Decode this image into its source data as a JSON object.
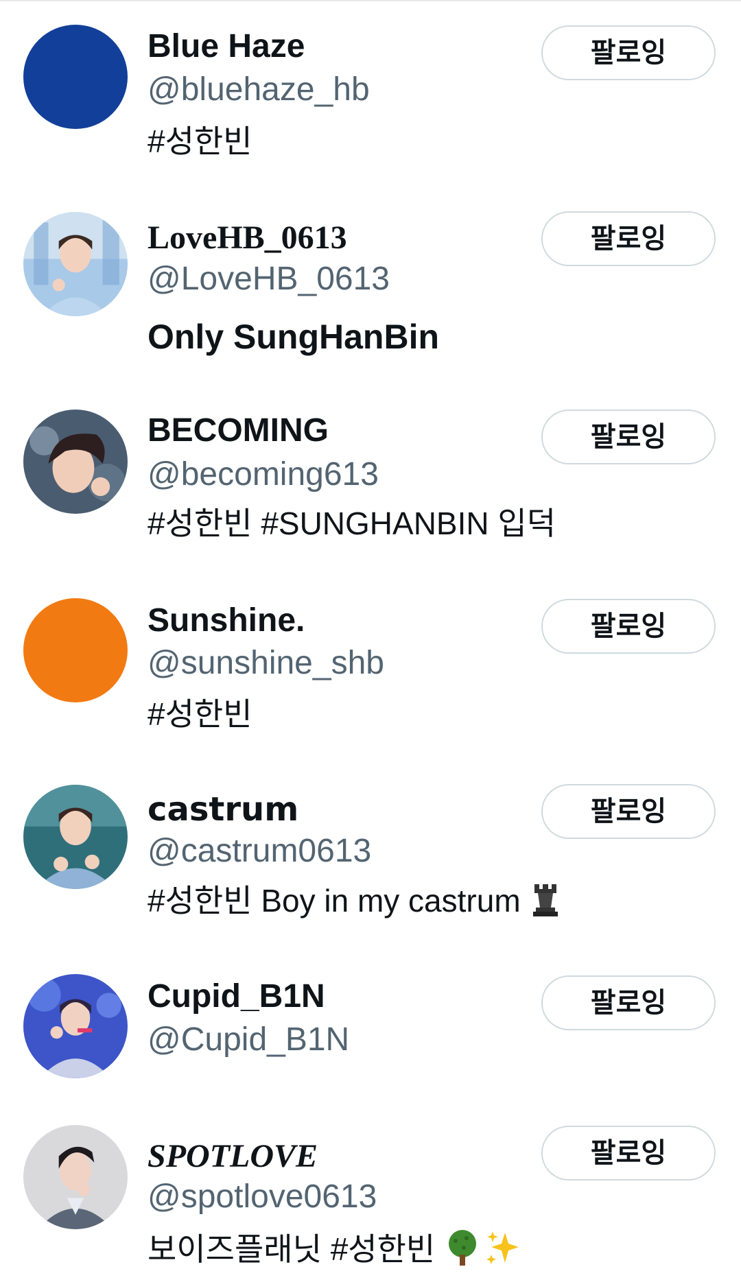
{
  "follow_list": {
    "follow_label": "팔로잉",
    "accounts": [
      {
        "name": "Blue Haze",
        "handle": "@bluehaze_hb",
        "bio": "#성한빈",
        "avatar": "solid-blue-avatar",
        "avatar_color": "#123f99"
      },
      {
        "name": "LoveHB_0613",
        "handle": "@LoveHB_0613",
        "bio": "Only SungHanBin",
        "avatar": "photo-avatar"
      },
      {
        "name": "BECOMING",
        "handle": "@becoming613",
        "bio": "#성한빈 #SUNGHANBIN 입덕",
        "avatar": "photo-avatar"
      },
      {
        "name": "Sunshine.",
        "handle": "@sunshine_shb",
        "bio": "#성한빈",
        "avatar": "solid-orange-avatar",
        "avatar_color": "#f27a12"
      },
      {
        "name": "castrum",
        "handle": "@castrum0613",
        "bio": "#성한빈 Boy in my castrum",
        "bio_icon": "chess-rook-icon",
        "avatar": "photo-avatar"
      },
      {
        "name": "Cupid_B1N",
        "handle": "@Cupid_B1N",
        "bio": "",
        "avatar": "photo-avatar"
      },
      {
        "name": "SPOTLOVE",
        "handle": "@spotlove0613",
        "bio": "보이즈플래닛 #성한빈",
        "bio_icons": [
          "tree-icon",
          "sparkles-icon"
        ],
        "avatar": "photo-avatar"
      }
    ]
  }
}
